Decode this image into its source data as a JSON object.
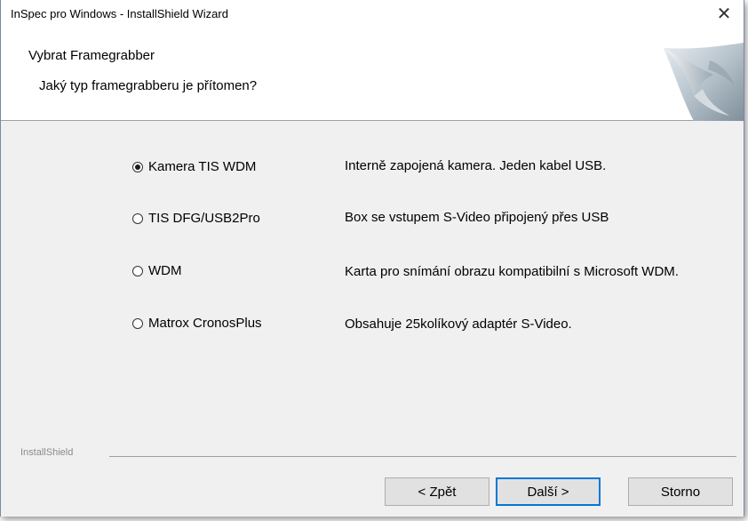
{
  "window": {
    "title": "InSpec pro Windows - InstallShield Wizard",
    "close_glyph": "✕"
  },
  "header": {
    "title": "Vybrat Framegrabber",
    "subtitle": "Jaký typ framegrabberu je přítomen?"
  },
  "options": [
    {
      "label": "Kamera TIS WDM",
      "description": "Interně zapojená kamera. Jeden kabel USB.",
      "selected": true
    },
    {
      "label": "TIS DFG/USB2Pro",
      "description": "Box se vstupem S-Video připojený přes USB",
      "selected": false
    },
    {
      "label": "WDM",
      "description": "Karta pro snímání obrazu kompatibilní s Microsoft WDM.",
      "selected": false
    },
    {
      "label": "Matrox CronosPlus",
      "description": "Obsahuje 25kolíkový adaptér S-Video.",
      "selected": false
    }
  ],
  "footer": {
    "brand": "InstallShield",
    "back_label": "< Zpět",
    "next_label": "Další >",
    "cancel_label": "Storno"
  },
  "colors": {
    "dialog_bg": "#f0f0f0",
    "header_bg": "#ffffff",
    "default_button_border": "#0078d7"
  }
}
